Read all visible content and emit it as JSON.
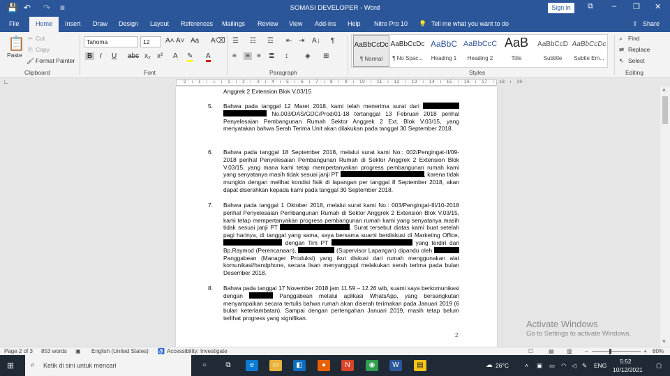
{
  "title_bar": {
    "doc_title": "SOMASI DEVELOPER  -  Word",
    "sign_in": "Sign in"
  },
  "tabs": [
    "File",
    "Home",
    "Insert",
    "Draw",
    "Design",
    "Layout",
    "References",
    "Mailings",
    "Review",
    "View",
    "Add-ins",
    "Help",
    "Nitro Pro 10"
  ],
  "tell_me": "Tell me what you want to do",
  "share": "Share",
  "ribbon": {
    "clipboard": {
      "paste": "Paste",
      "cut": "Cut",
      "copy": "Copy",
      "format_painter": "Format Painter",
      "label": "Clipboard"
    },
    "font": {
      "name": "Tahoma",
      "size": "12",
      "label": "Font"
    },
    "paragraph": {
      "label": "Paragraph"
    },
    "styles": {
      "label": "Styles",
      "items": [
        {
          "sample": "AaBbCcDc",
          "name": "¶ Normal"
        },
        {
          "sample": "AaBbCcDc",
          "name": "¶ No Spac..."
        },
        {
          "sample": "AaBbC",
          "name": "Heading 1"
        },
        {
          "sample": "AaBbCcC",
          "name": "Heading 2"
        },
        {
          "sample": "AaB",
          "name": "Title"
        },
        {
          "sample": "AaBbCcD",
          "name": "Subtitle"
        },
        {
          "sample": "AaBbCcDc",
          "name": "Subtle Em..."
        }
      ]
    },
    "editing": {
      "find": "Find",
      "replace": "Replace",
      "select": "Select",
      "label": "Editing"
    }
  },
  "ruler": "· 2 · ı · 1 · ı · ⌂ · ı · 1 · ı · 2 · ı · 3 · ı · 4 · ı · 5 · ı · 6 · ı · 7 · ı · 8 · ı · 9 · ı · 10 · ı · 11 · ı · 12 · ı · 13 · ı · 14 · ı · 15 · ı · 16 · ı · 17 · ı · 18 · ı · 19 ·",
  "document": {
    "top_line": "Anggrek 2 Extension Blok V.03/15",
    "items": [
      {
        "num": "5.",
        "parts": [
          "Bahwa pada tanggal 12 Maret 2018, kami telah menerima surat dari ",
          "[R]",
          " ",
          "[R]",
          " No.003/DAS/GDC/Prod/01-18 tertanggal 13 Februari 2018 perihal Penyelesaian Pembangunan Rumah Sektor Anggrek 2 Ext. Blok V.03/15, yang menyatakan bahwa Serah Terima Unit akan dilakukan pada tanggal 30 September 2018."
        ]
      },
      {
        "num": "6.",
        "parts": [
          "Bahwa pada tanggal 18 September 2018, melalui surat kami No.: 002/Pengingat-II/09-2018 perihal Penyelesaian Pembangunan Rumah di Sektor Anggrek 2 Extension Blok V.03/15, yang mana kami tetap mempertanyakan progress pembangunan rumah kami yang senyatanya masih tidak sesuai janji PT ",
          "[R]",
          ", karena tidak mungkin dengan melihat kondisi fisik di lapangan per tanggal 8 September 2018, akan dapat diserahkan kepada kami pada tanggal 30 September 2018."
        ]
      },
      {
        "num": "7.",
        "parts": [
          "Bahwa pada tanggal 1 Oktober 2018, melalui surat kami No.: 003/Pengingat-III/10-2018 perihal Penyelesaian Pembangunan Rumah di Sektor Anggrek 2 Extension Blok V.03/15, kami tetap mempertanyakan progress pembangunan rumah kami yang senyatanya masih tidak sesuai janji PT ",
          "[R]",
          ". Surat tersebut diatas kami buat setelah pagi harinya, di tanggal yang sama, saya bersama suami berdiskusi di Marketing Office, ",
          "[R]",
          " dengan Tim PT ",
          "[R]",
          " yang terdiri dari Bp.Raymod (Perencanaan), ",
          "[R]",
          " (Supervisor Lapangan) dipandu oleh ",
          "[R]",
          " Panggabean (Manager Produksi) yang ikut diskusi dari rumah menggunakan alat komunikasi/handphone, secara lisan menyanggupi melakukan serah terima pada bulan Desember 2018."
        ]
      },
      {
        "num": "8.",
        "parts": [
          "Bahwa pada tanggal 17 November 2018 jam 11.59 – 12.26 wib, suami saya berkomunikasi dengan ",
          "[R]",
          " Panggabean melalui aplikasi WhatsApp, yang bersangkutan menyampaikan secara tertulis bahwa rumah akan diserah terimakan pada Januari 2019 (6 bulan keterlambatan). Sampai dengan pertengahan Januari 2019, masih tetap belum terlihat progress yang signifikan."
        ]
      }
    ],
    "page_number": "2"
  },
  "watermark": {
    "line1": "Activate Windows",
    "line2": "Go to Settings to activate Windows."
  },
  "status_bar": {
    "page": "Page 2 of 3",
    "words": "853 words",
    "language": "English (United States)",
    "accessibility": "Accessibility: Investigate",
    "zoom": "80%"
  },
  "taskbar": {
    "search": "Ketik di sini untuk mencari",
    "weather": "26°C",
    "lang": "ENG",
    "time": "5:52",
    "date": "10/12/2021"
  }
}
